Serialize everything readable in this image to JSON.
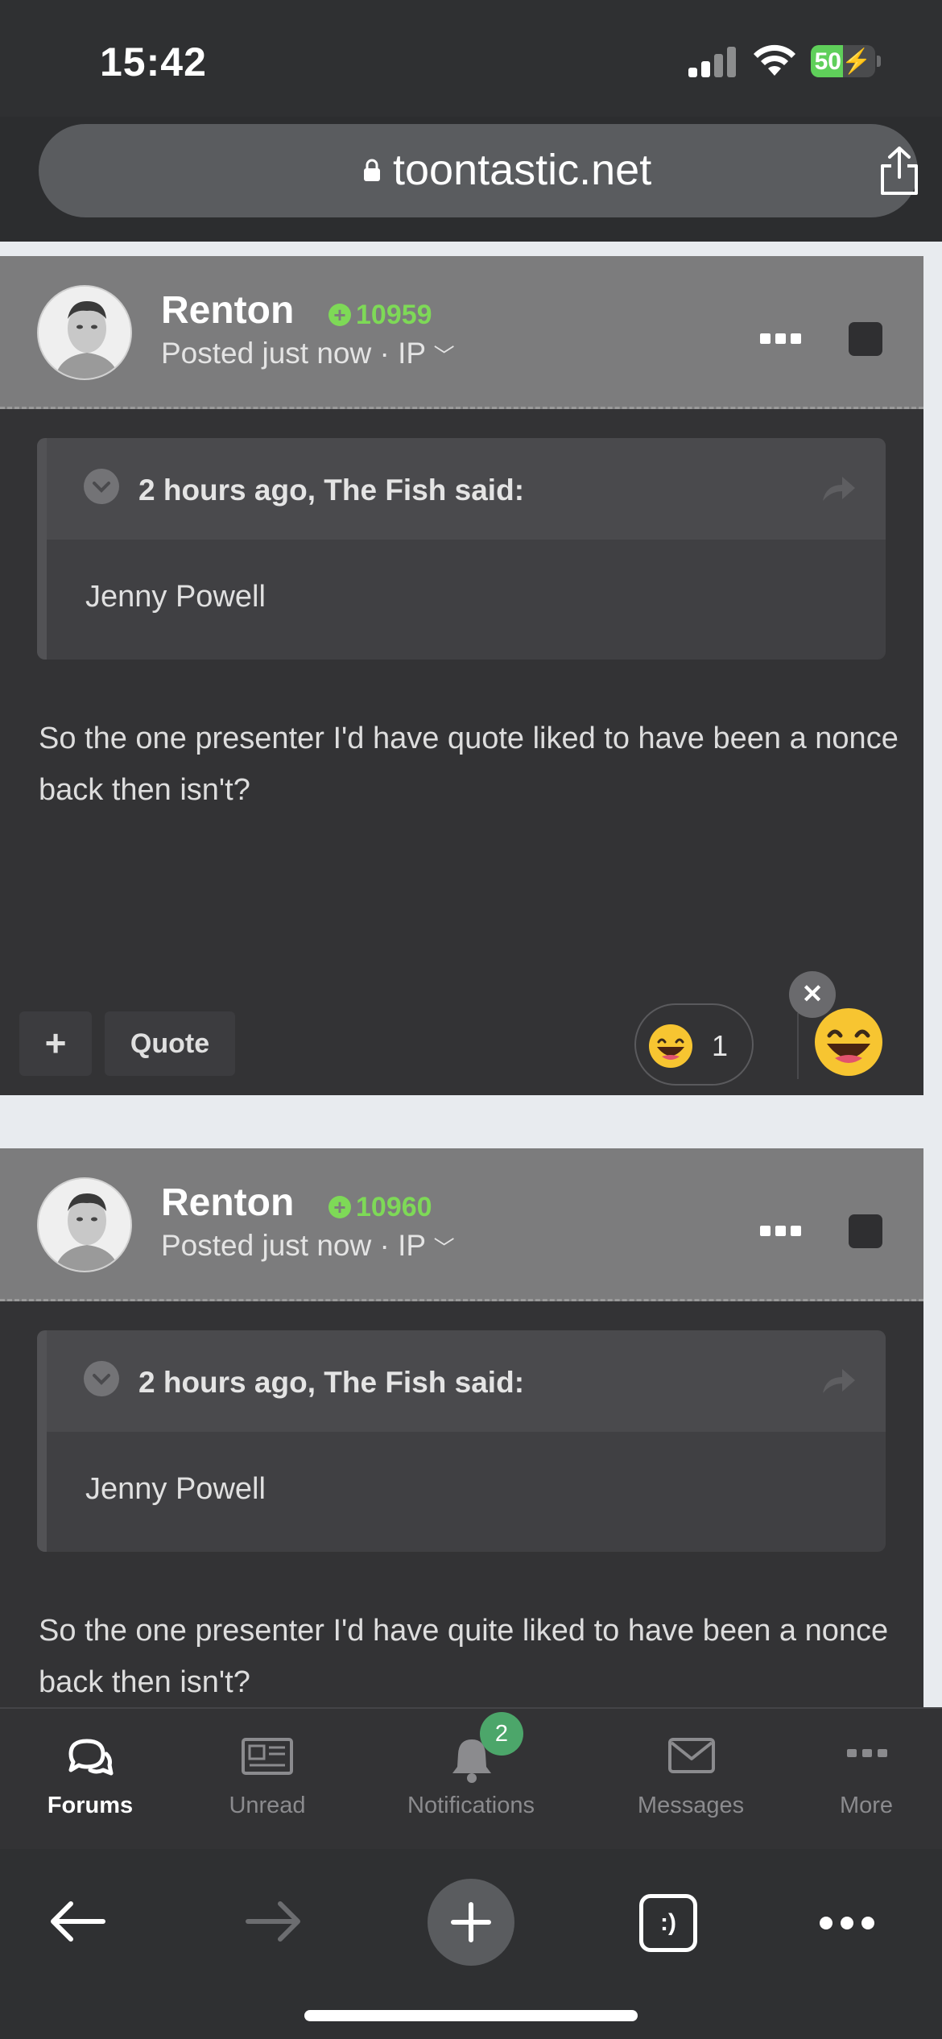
{
  "status_bar": {
    "time": "15:42",
    "battery_percent": "50",
    "battery_level": 0.5
  },
  "browser": {
    "url": "toontastic.net"
  },
  "posts": [
    {
      "username": "Renton",
      "reputation": "10959",
      "meta": "Posted just now · IP",
      "quote": {
        "cite": "2 hours ago, The Fish said:",
        "body": "Jenny Powell"
      },
      "text": "So the one presenter I'd have quote liked to have been a nonce back then isn't?",
      "actions": {
        "plus": "+",
        "quote": "Quote"
      },
      "reaction": {
        "emoji": "grinning-face",
        "count": "1"
      }
    },
    {
      "username": "Renton",
      "reputation": "10960",
      "meta": "Posted just now · IP",
      "quote": {
        "cite": "2 hours ago, The Fish said:",
        "body": "Jenny Powell"
      },
      "text": "So the one presenter I'd have quite liked to have been a nonce back then isn't?"
    }
  ],
  "tabbar": {
    "items": [
      {
        "label": "Forums",
        "icon": "chat-bubbles-icon",
        "active": true
      },
      {
        "label": "Unread",
        "icon": "newspaper-icon",
        "active": false
      },
      {
        "label": "Notifications",
        "icon": "bell-icon",
        "badge": "2",
        "active": false
      },
      {
        "label": "Messages",
        "icon": "envelope-icon",
        "active": false
      },
      {
        "label": "More",
        "icon": "more-dots-icon",
        "active": false
      }
    ]
  },
  "browser_toolbar": {
    "buttons": [
      "back-arrow-icon",
      "forward-arrow-icon",
      "new-tab-plus-icon",
      "tabs-icon",
      "menu-dots-icon"
    ],
    "tabs_label": ":)"
  },
  "colors": {
    "reputation_green": "#7ed957",
    "badge_green": "#4ca66a",
    "battery_green": "#5fcf5a"
  }
}
